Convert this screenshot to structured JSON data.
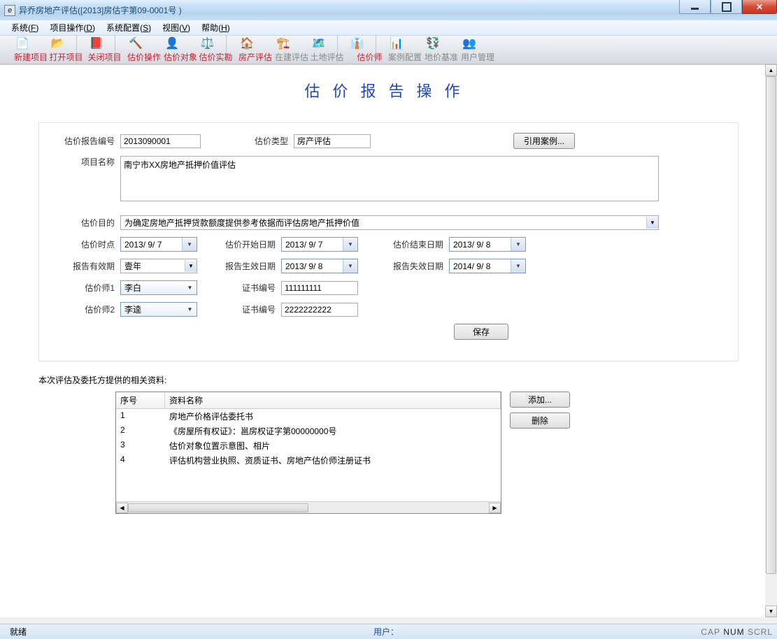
{
  "window": {
    "title": "异乔房地产评估([2013]房估字第09-0001号 )"
  },
  "menubar": [
    {
      "label": "系统",
      "hotkey": "F"
    },
    {
      "label": "项目操作",
      "hotkey": "D"
    },
    {
      "label": "系统配置",
      "hotkey": "S"
    },
    {
      "label": "视图",
      "hotkey": "V"
    },
    {
      "label": "帮助",
      "hotkey": "H"
    }
  ],
  "toolbar": [
    {
      "label": "新建项目",
      "kind": "red",
      "icon": "📄"
    },
    {
      "label": "打开项目",
      "kind": "red",
      "icon": "📂",
      "sep": true
    },
    {
      "label": "关闭项目",
      "kind": "red",
      "icon": "📕",
      "sep": true
    },
    {
      "label": "估价操作",
      "kind": "red",
      "icon": "🔨"
    },
    {
      "label": "估价对象",
      "kind": "red",
      "icon": "👤"
    },
    {
      "label": "估价实勘",
      "kind": "red",
      "icon": "⚖️",
      "sep": true
    },
    {
      "label": "房产评估",
      "kind": "red",
      "icon": "🏠"
    },
    {
      "label": "在建评估",
      "kind": "gray",
      "icon": "🏗️"
    },
    {
      "label": "土地评估",
      "kind": "gray",
      "icon": "🗺️",
      "sep": true
    },
    {
      "label": "估价师",
      "kind": "red",
      "icon": "👔",
      "sep": true
    },
    {
      "label": "案例配置",
      "kind": "gray",
      "icon": "📊"
    },
    {
      "label": "地价基准",
      "kind": "gray",
      "icon": "💱"
    },
    {
      "label": "用户管理",
      "kind": "gray",
      "icon": "👥"
    }
  ],
  "page": {
    "heading": "估价报告操作"
  },
  "form": {
    "labels": {
      "report_no": "估价报告编号",
      "appraisal_type": "估价类型",
      "ref_case_btn": "引用案例...",
      "project_name": "项目名称",
      "purpose": "估价目的",
      "appraisal_date": "估价时点",
      "start_date": "估价开始日期",
      "end_date": "估价结束日期",
      "validity": "报告有效期",
      "effective_date": "报告生效日期",
      "expiry_date": "报告失效日期",
      "appraiser1": "估价师1",
      "appraiser2": "估价师2",
      "cert_no": "证书编号",
      "save_btn": "保存"
    },
    "values": {
      "report_no": "2013090001",
      "appraisal_type": "房产评估",
      "project_name": "南宁市XX房地产抵押价值评估",
      "purpose": "为确定房地产抵押贷款额度提供参考依据而评估房地产抵押价值",
      "appraisal_date": "2013/ 9/ 7",
      "start_date": "2013/ 9/ 7",
      "end_date": "2013/ 9/ 8",
      "validity": "壹年",
      "effective_date": "2013/ 9/ 8",
      "expiry_date": "2014/ 9/ 8",
      "appraiser1": "李白",
      "appraiser2": "李逵",
      "cert_no1": "111111111",
      "cert_no2": "2222222222"
    }
  },
  "materials": {
    "label": "本次评估及委托方提供的相关资料:",
    "add_btn": "添加...",
    "del_btn": "删除",
    "columns": {
      "no": "序号",
      "name": "资料名称"
    },
    "rows": [
      {
        "no": "1",
        "name": "房地产价格评估委托书"
      },
      {
        "no": "2",
        "name": "《房屋所有权证》：邕房权证字第00000000号"
      },
      {
        "no": "3",
        "name": "估价对象位置示意图、相片"
      },
      {
        "no": "4",
        "name": "评估机构营业执照、资质证书、房地产估价师注册证书"
      }
    ]
  },
  "statusbar": {
    "ready": "就绪",
    "user_label": "用户：",
    "cap": "CAP",
    "num": "NUM",
    "scrl": "SCRL"
  }
}
